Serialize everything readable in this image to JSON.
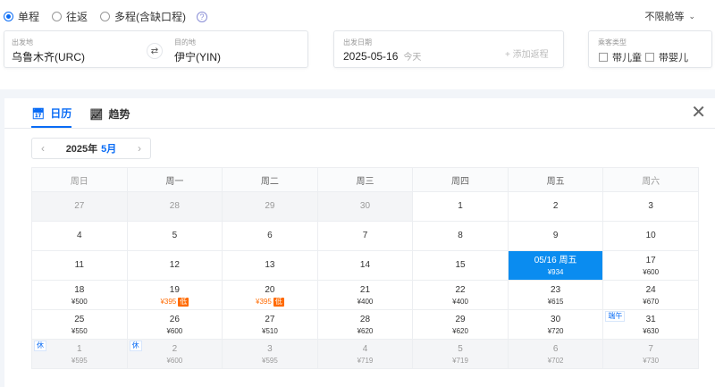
{
  "trip_types": [
    {
      "label": "单程",
      "selected": true
    },
    {
      "label": "往返",
      "selected": false
    },
    {
      "label": "多程(含缺口程)",
      "selected": false
    }
  ],
  "cabin": {
    "label": "不限舱等"
  },
  "search": {
    "from_label": "出发地",
    "from_value": "乌鲁木齐(URC)",
    "to_label": "目的地",
    "to_value": "伊宁(YIN)",
    "date_label": "出发日期",
    "date_value": "2025-05-16",
    "date_sub": "今天",
    "add_return": "+ 添加返程",
    "passenger_label": "乘客类型",
    "with_child": "带儿童",
    "with_infant": "带婴儿"
  },
  "tabs": [
    {
      "label": "日历"
    },
    {
      "label": "趋势"
    }
  ],
  "calendar": {
    "year_label": "2025年",
    "month_label": "5月",
    "weekdays": [
      "周日",
      "周一",
      "周二",
      "周三",
      "周四",
      "周五",
      "周六"
    ],
    "weeks": [
      [
        {
          "d": "27",
          "s": "past"
        },
        {
          "d": "28",
          "s": "past"
        },
        {
          "d": "29",
          "s": "past"
        },
        {
          "d": "30",
          "s": "past"
        },
        {
          "d": "1"
        },
        {
          "d": "2"
        },
        {
          "d": "3"
        }
      ],
      [
        {
          "d": "4"
        },
        {
          "d": "5"
        },
        {
          "d": "6"
        },
        {
          "d": "7"
        },
        {
          "d": "8"
        },
        {
          "d": "9"
        },
        {
          "d": "10"
        }
      ],
      [
        {
          "d": "11"
        },
        {
          "d": "12"
        },
        {
          "d": "13"
        },
        {
          "d": "14"
        },
        {
          "d": "15"
        },
        {
          "d": "05/16 周五",
          "p": "¥934",
          "s": "sel"
        },
        {
          "d": "17",
          "p": "¥600"
        }
      ],
      [
        {
          "d": "18",
          "p": "¥500"
        },
        {
          "d": "19",
          "p": "¥395",
          "s": "low",
          "tag": "低"
        },
        {
          "d": "20",
          "p": "¥395",
          "s": "low",
          "tag": "低"
        },
        {
          "d": "21",
          "p": "¥400"
        },
        {
          "d": "22",
          "p": "¥400"
        },
        {
          "d": "23",
          "p": "¥615"
        },
        {
          "d": "24",
          "p": "¥670"
        }
      ],
      [
        {
          "d": "25",
          "p": "¥550"
        },
        {
          "d": "26",
          "p": "¥600"
        },
        {
          "d": "27",
          "p": "¥510"
        },
        {
          "d": "28",
          "p": "¥620"
        },
        {
          "d": "29",
          "p": "¥620"
        },
        {
          "d": "30",
          "p": "¥720"
        },
        {
          "d": "31",
          "p": "¥630",
          "hol": "端午"
        }
      ],
      [
        {
          "d": "1",
          "p": "¥595",
          "s": "next",
          "hol": "休"
        },
        {
          "d": "2",
          "p": "¥600",
          "s": "next",
          "hol": "休"
        },
        {
          "d": "3",
          "p": "¥595",
          "s": "next"
        },
        {
          "d": "4",
          "p": "¥719",
          "s": "next"
        },
        {
          "d": "5",
          "p": "¥719",
          "s": "next"
        },
        {
          "d": "6",
          "p": "¥702",
          "s": "next"
        },
        {
          "d": "7",
          "p": "¥730",
          "s": "next"
        }
      ]
    ]
  }
}
